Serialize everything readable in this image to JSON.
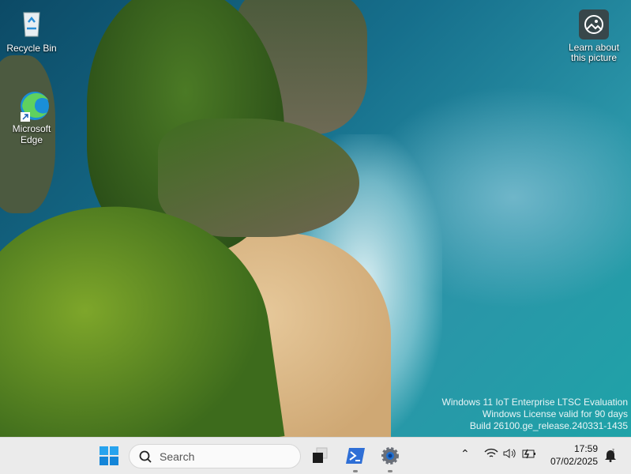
{
  "desktop": {
    "icons": [
      {
        "label": "Recycle Bin",
        "icon": "recycle-bin-icon"
      },
      {
        "label": "Microsoft Edge",
        "icon": "edge-icon"
      }
    ],
    "learn_about": "Learn about this picture",
    "watermark": [
      "Windows 11 IoT Enterprise LTSC Evaluation",
      "Windows License valid for 90 days",
      "Build 26100.ge_release.240331-1435"
    ]
  },
  "taskbar": {
    "search_placeholder": "Search",
    "apps": [
      "start-icon",
      "task-view-icon",
      "powershell-icon",
      "settings-icon"
    ],
    "clock": {
      "time": "17:59",
      "date": "07/02/2025"
    },
    "tray": [
      "chevron-up-icon",
      "wifi-icon",
      "volume-icon",
      "battery-icon",
      "notification-bell-icon"
    ]
  }
}
